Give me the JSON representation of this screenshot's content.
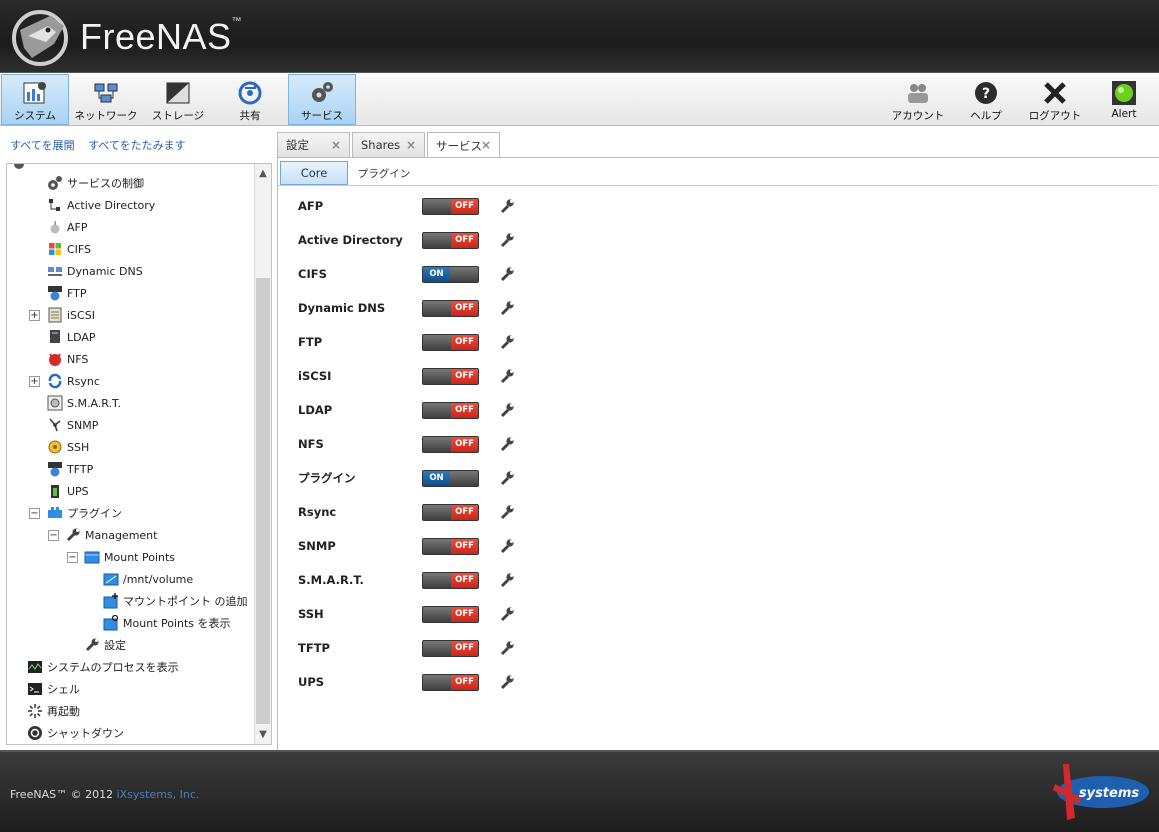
{
  "header": {
    "brand": "FreeNAS",
    "tm": "™"
  },
  "toolbar": {
    "left": [
      {
        "label": "システム",
        "icon": "system-icon",
        "active": true
      },
      {
        "label": "ネットワーク",
        "icon": "network-icon",
        "active": false
      },
      {
        "label": "ストレージ",
        "icon": "storage-icon",
        "active": false
      },
      {
        "label": "共有",
        "icon": "sharing-icon",
        "active": false
      },
      {
        "label": "サービス",
        "icon": "services-icon",
        "active": true
      }
    ],
    "right": [
      {
        "label": "アカウント",
        "icon": "account-icon"
      },
      {
        "label": "ヘルプ",
        "icon": "help-icon"
      },
      {
        "label": "ログアウト",
        "icon": "logout-icon"
      },
      {
        "label": "Alert",
        "icon": "alert-icon"
      }
    ]
  },
  "sidebar": {
    "expand_all": "すべてを展開",
    "collapse_all": "すべてをたたみます",
    "items": [
      {
        "label": "サービスの制御",
        "icon": "gears-icon"
      },
      {
        "label": "Active Directory",
        "icon": "directory-icon"
      },
      {
        "label": "AFP",
        "icon": "apple-icon"
      },
      {
        "label": "CIFS",
        "icon": "windows-icon"
      },
      {
        "label": "Dynamic DNS",
        "icon": "dns-icon"
      },
      {
        "label": "FTP",
        "icon": "ftp-icon"
      },
      {
        "label": "iSCSI",
        "icon": "iscsi-icon"
      },
      {
        "label": "LDAP",
        "icon": "ldap-icon"
      },
      {
        "label": "NFS",
        "icon": "nfs-icon"
      },
      {
        "label": "Rsync",
        "icon": "rsync-icon"
      },
      {
        "label": "S.M.A.R.T.",
        "icon": "smart-icon"
      },
      {
        "label": "SNMP",
        "icon": "snmp-icon"
      },
      {
        "label": "SSH",
        "icon": "ssh-icon"
      },
      {
        "label": "TFTP",
        "icon": "tftp-icon"
      },
      {
        "label": "UPS",
        "icon": "ups-icon"
      },
      {
        "label": "プラグイン",
        "icon": "plugin-icon"
      },
      {
        "label": "Management",
        "icon": "wrench-icon"
      },
      {
        "label": "Mount Points",
        "icon": "folder-icon"
      },
      {
        "label": "/mnt/volume",
        "icon": "folder-icon"
      },
      {
        "label": "マウントポイント の追加",
        "icon": "folder-add-icon"
      },
      {
        "label": "Mount Points を表示",
        "icon": "folder-view-icon"
      },
      {
        "label": "設定",
        "icon": "wrench-icon"
      },
      {
        "label": "システムのプロセスを表示",
        "icon": "process-icon"
      },
      {
        "label": "シェル",
        "icon": "shell-icon"
      },
      {
        "label": "再起動",
        "icon": "reboot-icon"
      },
      {
        "label": "シャットダウン",
        "icon": "shutdown-icon"
      }
    ]
  },
  "tabs": [
    {
      "label": "設定",
      "active": false
    },
    {
      "label": "Shares",
      "active": false
    },
    {
      "label": "サービス",
      "active": true
    }
  ],
  "subtabs": [
    {
      "label": "Core",
      "active": true
    },
    {
      "label": "プラグイン",
      "active": false
    }
  ],
  "services": [
    {
      "name": "AFP",
      "state": "OFF"
    },
    {
      "name": "Active Directory",
      "state": "OFF"
    },
    {
      "name": "CIFS",
      "state": "ON"
    },
    {
      "name": "Dynamic DNS",
      "state": "OFF"
    },
    {
      "name": "FTP",
      "state": "OFF"
    },
    {
      "name": "iSCSI",
      "state": "OFF"
    },
    {
      "name": "LDAP",
      "state": "OFF"
    },
    {
      "name": "NFS",
      "state": "OFF"
    },
    {
      "name": "プラグイン",
      "state": "ON"
    },
    {
      "name": "Rsync",
      "state": "OFF"
    },
    {
      "name": "SNMP",
      "state": "OFF"
    },
    {
      "name": "S.M.A.R.T.",
      "state": "OFF"
    },
    {
      "name": "SSH",
      "state": "OFF"
    },
    {
      "name": "TFTP",
      "state": "OFF"
    },
    {
      "name": "UPS",
      "state": "OFF"
    }
  ],
  "footer": {
    "copyright": "FreeNAS™ © 2012 ",
    "company": "iXsystems, Inc.",
    "logo_text": "systems"
  },
  "colors": {
    "on": "#0f4c86",
    "off": "#c9261a",
    "accent": "#2a5fa8"
  }
}
